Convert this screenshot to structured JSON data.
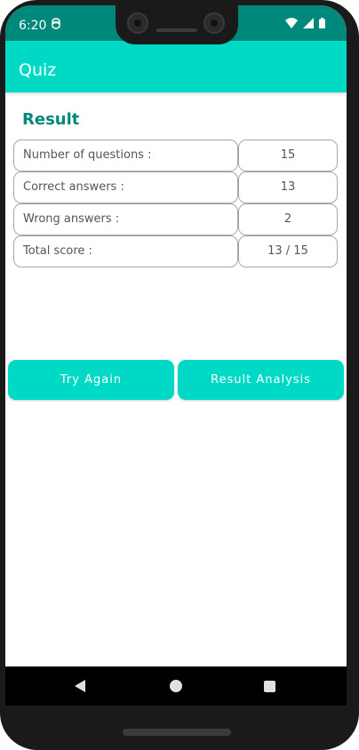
{
  "status_bar": {
    "time": "6:20",
    "icons": [
      "vpn-icon",
      "wifi-icon",
      "cellular-signal-icon",
      "battery-icon"
    ]
  },
  "app_bar": {
    "title": "Quiz"
  },
  "result": {
    "heading": "Result",
    "rows": [
      {
        "label": "Number of questions :",
        "value": "15"
      },
      {
        "label": "Correct answers :",
        "value": "13"
      },
      {
        "label": "Wrong answers :",
        "value": "2"
      },
      {
        "label": "Total score :",
        "value": "13 / 15"
      }
    ]
  },
  "buttons": {
    "try_again": "Try Again",
    "result_analysis": "Result Analysis"
  },
  "nav_bar": {
    "icons": [
      "back-icon",
      "home-icon",
      "recents-icon"
    ]
  },
  "colors": {
    "status_bar": "#00897b",
    "app_bar": "#00d9c5",
    "accent_text": "#00897b",
    "button": "#00d9c5"
  }
}
